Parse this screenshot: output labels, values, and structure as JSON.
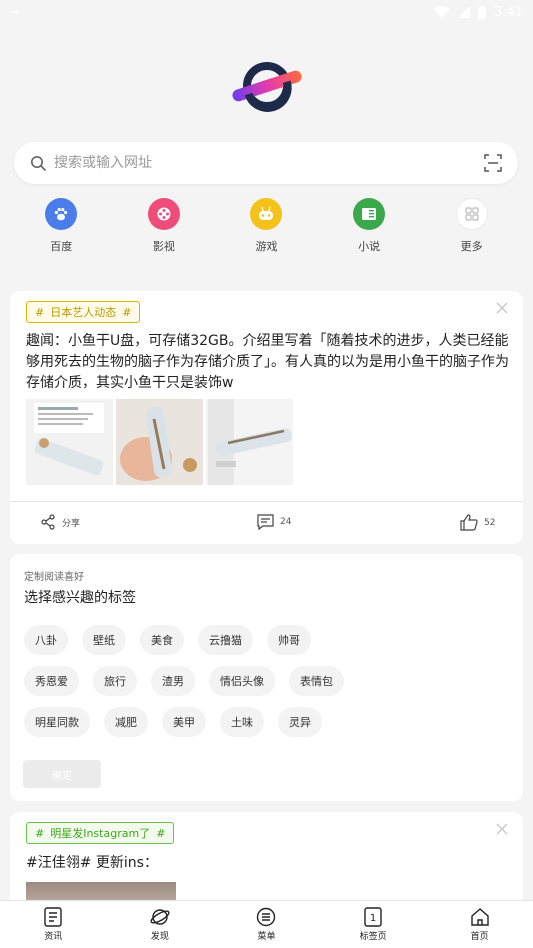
{
  "statusbar": {
    "time": "3:41"
  },
  "search": {
    "placeholder": "搜索或输入网址"
  },
  "shortcuts": [
    {
      "label": "百度",
      "icon": "paw-icon",
      "color": "#4a7dea"
    },
    {
      "label": "影视",
      "icon": "film-reel-icon",
      "color": "#ee4d7a"
    },
    {
      "label": "游戏",
      "icon": "gamepad-icon",
      "color": "#f4c21b"
    },
    {
      "label": "小说",
      "icon": "book-icon",
      "color": "#3ba94b"
    },
    {
      "label": "更多",
      "icon": "grid-icon",
      "color": "#f0f0f0"
    }
  ],
  "card1": {
    "tag": "日本艺人动态",
    "text": "趣闻：小鱼干U盘，可存储32GB。介绍里写着「随着技术的进步，人类已经能够用死去的生物的脑子作为存储介质了」。有人真的以为是用小鱼干的脑子作为存储介质，其实小鱼干只是装饰w",
    "share_label": "分享",
    "comment_count": "24",
    "like_count": "52"
  },
  "card2": {
    "subtitle": "定制阅读喜好",
    "title": "选择感兴趣的标签",
    "rows": [
      [
        "八卦",
        "壁纸",
        "美食",
        "云撸猫",
        "帅哥"
      ],
      [
        "秀恩爱",
        "旅行",
        "渣男",
        "情侣头像",
        "表情包"
      ],
      [
        "明星同款",
        "减肥",
        "美甲",
        "土味",
        "灵异"
      ]
    ],
    "confirm_label": "确定"
  },
  "card3": {
    "tag": "明星发Instagram了",
    "title": "#汪佳翎# 更新ins："
  },
  "bottomnav": [
    {
      "label": "资讯",
      "icon": "news-icon"
    },
    {
      "label": "发现",
      "icon": "planet-icon"
    },
    {
      "label": "菜单",
      "icon": "menu-icon"
    },
    {
      "label": "标签页",
      "icon": "tabs-icon",
      "count": "1"
    },
    {
      "label": "首页",
      "icon": "home-icon"
    }
  ]
}
